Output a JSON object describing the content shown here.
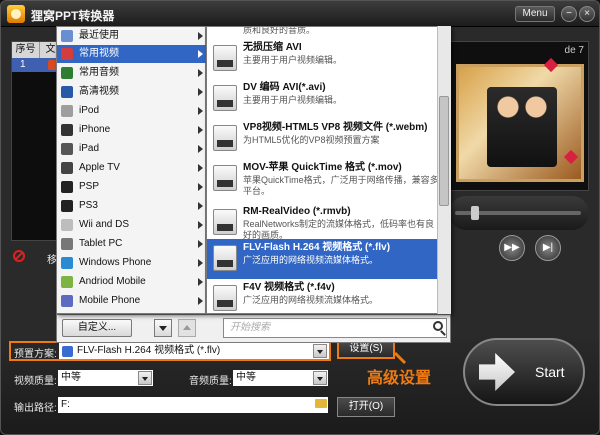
{
  "window": {
    "title": "狸窝PPT转换器",
    "menu_label": "Menu",
    "minimize_glyph": "−",
    "close_glyph": "×"
  },
  "file_table": {
    "headers": [
      "序号",
      "文"
    ],
    "rows": [
      {
        "index": "1"
      }
    ]
  },
  "left_controls": {
    "move_label": "移"
  },
  "preview": {
    "slide_label": "de 7"
  },
  "category_menu": {
    "items": [
      {
        "label": "最近使用",
        "icon": "clock-icon",
        "color": "#6a8fd0"
      },
      {
        "label": "常用视频",
        "icon": "film-icon",
        "color": "#d23d3d",
        "selected": true
      },
      {
        "label": "常用音频",
        "icon": "music-icon",
        "color": "#2f7d32"
      },
      {
        "label": "高清视频",
        "icon": "hd-icon",
        "color": "#2859a8"
      },
      {
        "label": "iPod",
        "icon": "ipod-icon",
        "color": "#9e9e9e"
      },
      {
        "label": "iPhone",
        "icon": "iphone-icon",
        "color": "#333333"
      },
      {
        "label": "iPad",
        "icon": "ipad-icon",
        "color": "#555555"
      },
      {
        "label": "Apple TV",
        "icon": "appletv-icon",
        "color": "#444444"
      },
      {
        "label": "PSP",
        "icon": "psp-icon",
        "color": "#222222"
      },
      {
        "label": "PS3",
        "icon": "ps3-icon",
        "color": "#222222"
      },
      {
        "label": "Wii and DS",
        "icon": "wii-icon",
        "color": "#bdbdbd"
      },
      {
        "label": "Tablet PC",
        "icon": "tablet-icon",
        "color": "#777777"
      },
      {
        "label": "Windows Phone",
        "icon": "windows-phone-icon",
        "color": "#2a8ad4"
      },
      {
        "label": "Andriod Mobile",
        "icon": "android-icon",
        "color": "#7cb342"
      },
      {
        "label": "Mobile Phone",
        "icon": "mobile-phone-icon",
        "color": "#5c6bc0"
      }
    ]
  },
  "format_list": {
    "partial_top_desc": "质和良好的音质。",
    "items": [
      {
        "title": "无损压缩 AVI",
        "desc": "主要用于用户视频编辑。"
      },
      {
        "title": "DV 编码 AVI(*.avi)",
        "desc": "主要用于用户视频编辑。"
      },
      {
        "title": "VP8视频-HTML5 VP8 视频文件 (*.webm)",
        "desc": "为HTML5优化的VP8视频预置方案"
      },
      {
        "title": "MOV-苹果 QuickTime 格式 (*.mov)",
        "desc": "苹果QuickTime格式，广泛用于网络传播，兼容多平台。"
      },
      {
        "title": "RM-RealVideo (*.rmvb)",
        "desc": "RealNetworks制定的流媒体格式，低码率也有良好的画质。"
      },
      {
        "title": "FLV-Flash H.264 视频格式 (*.flv)",
        "desc": "广泛应用的网络视频流媒体格式。",
        "selected": true
      },
      {
        "title": "F4V 视频格式 (*.f4v)",
        "desc": "广泛应用的网络视频流媒体格式。"
      }
    ]
  },
  "dropdown_footer": {
    "custom_label": "自定义...",
    "search_placeholder": "开始搜索"
  },
  "settings": {
    "preset_label": "预置方案:",
    "preset_value": "FLV-Flash H.264 视频格式 (*.flv)",
    "settings_button": "设置(S)",
    "video_quality_label": "视频质量:",
    "video_quality_value": "中等",
    "audio_quality_label": "音频质量:",
    "audio_quality_value": "中等",
    "output_path_label": "输出路径:",
    "output_path_value": "F:",
    "open_button": "打开(O)",
    "annotation": "高级设置",
    "start_label": "Start"
  },
  "colors": {
    "accent_orange": "#f07a10",
    "selection_blue": "#3166c4"
  }
}
